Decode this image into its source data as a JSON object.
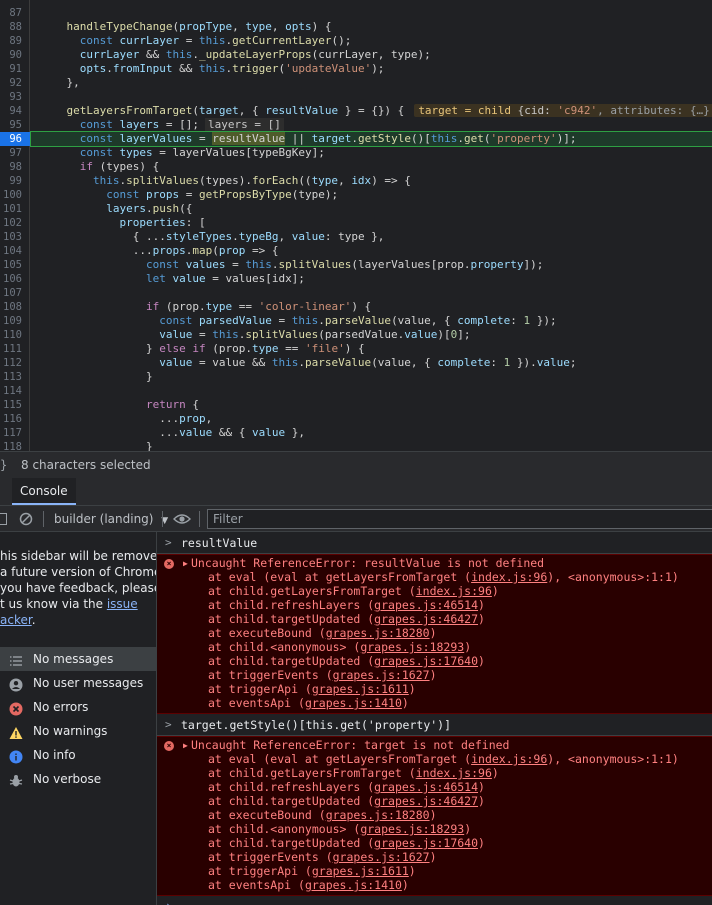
{
  "editor": {
    "active_line": "96",
    "lines": [
      {
        "n": "87",
        "segs": []
      },
      {
        "n": "88",
        "segs": [
          [
            "    ",
            "p"
          ],
          [
            "handleTypeChange",
            "f"
          ],
          [
            "(",
            "p"
          ],
          [
            "propType",
            "v"
          ],
          [
            ", ",
            "p"
          ],
          [
            "type",
            "v"
          ],
          [
            ", ",
            "p"
          ],
          [
            "opts",
            "v"
          ],
          [
            ") {",
            "p"
          ]
        ]
      },
      {
        "n": "89",
        "segs": [
          [
            "      ",
            "p"
          ],
          [
            "const ",
            "k2"
          ],
          [
            "currLayer",
            "v"
          ],
          [
            " = ",
            "p"
          ],
          [
            "this",
            "k2"
          ],
          [
            ".",
            "p"
          ],
          [
            "getCurrentLayer",
            "f"
          ],
          [
            "();",
            "p"
          ]
        ]
      },
      {
        "n": "90",
        "segs": [
          [
            "      ",
            "p"
          ],
          [
            "currLayer",
            "v"
          ],
          [
            " && ",
            "p"
          ],
          [
            "this",
            "k2"
          ],
          [
            ".",
            "p"
          ],
          [
            "_updateLayerProps",
            "f"
          ],
          [
            "(currLayer, type);",
            "p"
          ]
        ]
      },
      {
        "n": "91",
        "segs": [
          [
            "      ",
            "p"
          ],
          [
            "opts",
            "v"
          ],
          [
            ".",
            "p"
          ],
          [
            "fromInput",
            "v"
          ],
          [
            " && ",
            "p"
          ],
          [
            "this",
            "k2"
          ],
          [
            ".",
            "p"
          ],
          [
            "trigger",
            "f"
          ],
          [
            "(",
            "p"
          ],
          [
            "'updateValue'",
            "s"
          ],
          [
            ");",
            "p"
          ]
        ]
      },
      {
        "n": "92",
        "segs": [
          [
            "    },",
            "p"
          ]
        ]
      },
      {
        "n": "93",
        "segs": []
      },
      {
        "n": "94",
        "segs": [
          [
            "    ",
            "p"
          ],
          [
            "getLayersFromTarget",
            "f"
          ],
          [
            "(",
            "p"
          ],
          [
            "target",
            "v"
          ],
          [
            ", { ",
            "p"
          ],
          [
            "resultValue",
            "v"
          ],
          [
            " } = {}) {",
            "p"
          ]
        ],
        "inline": "94"
      },
      {
        "n": "95",
        "segs": [
          [
            "      ",
            "p"
          ],
          [
            "const ",
            "k2"
          ],
          [
            "layers",
            "v"
          ],
          [
            " = [];",
            "p"
          ]
        ],
        "inline": "95"
      },
      {
        "n": "96",
        "segs": [
          [
            "      ",
            "p"
          ],
          [
            "const ",
            "k2"
          ],
          [
            "layerValues",
            "v"
          ],
          [
            " = ",
            "p"
          ],
          [
            "resultValue",
            "sel"
          ],
          [
            " || ",
            "p"
          ],
          [
            "target",
            "v"
          ],
          [
            ".",
            "p"
          ],
          [
            "getStyle",
            "f"
          ],
          [
            "()[",
            "p"
          ],
          [
            "this",
            "k2"
          ],
          [
            ".",
            "p"
          ],
          [
            "get",
            "f"
          ],
          [
            "(",
            "p"
          ],
          [
            "'property'",
            "s"
          ],
          [
            ")];",
            "p"
          ]
        ]
      },
      {
        "n": "97",
        "segs": [
          [
            "      ",
            "p"
          ],
          [
            "const ",
            "k2"
          ],
          [
            "types",
            "v"
          ],
          [
            " = layerValues[typeBgKey];",
            "p"
          ]
        ]
      },
      {
        "n": "98",
        "segs": [
          [
            "      ",
            "p"
          ],
          [
            "if ",
            "k"
          ],
          [
            "(types) {",
            "p"
          ]
        ]
      },
      {
        "n": "99",
        "segs": [
          [
            "        ",
            "p"
          ],
          [
            "this",
            "k2"
          ],
          [
            ".",
            "p"
          ],
          [
            "splitValues",
            "f"
          ],
          [
            "(types).",
            "p"
          ],
          [
            "forEach",
            "f"
          ],
          [
            "((",
            "p"
          ],
          [
            "type",
            "v"
          ],
          [
            ", ",
            "p"
          ],
          [
            "idx",
            "v"
          ],
          [
            ") => {",
            "p"
          ]
        ]
      },
      {
        "n": "100",
        "segs": [
          [
            "          ",
            "p"
          ],
          [
            "const ",
            "k2"
          ],
          [
            "props",
            "v"
          ],
          [
            " = ",
            "p"
          ],
          [
            "getPropsByType",
            "f"
          ],
          [
            "(type);",
            "p"
          ]
        ]
      },
      {
        "n": "101",
        "segs": [
          [
            "          ",
            "p"
          ],
          [
            "layers",
            "v"
          ],
          [
            ".",
            "p"
          ],
          [
            "push",
            "f"
          ],
          [
            "({",
            "p"
          ]
        ]
      },
      {
        "n": "102",
        "segs": [
          [
            "            ",
            "p"
          ],
          [
            "properties",
            "v"
          ],
          [
            ": [",
            "p"
          ]
        ]
      },
      {
        "n": "103",
        "segs": [
          [
            "              { ...",
            "p"
          ],
          [
            "styleTypes",
            "v"
          ],
          [
            ".",
            "p"
          ],
          [
            "typeBg",
            "v"
          ],
          [
            ", ",
            "p"
          ],
          [
            "value",
            "v"
          ],
          [
            ": type },",
            "p"
          ]
        ]
      },
      {
        "n": "104",
        "segs": [
          [
            "              ...",
            "p"
          ],
          [
            "props",
            "v"
          ],
          [
            ".",
            "p"
          ],
          [
            "map",
            "f"
          ],
          [
            "(",
            "p"
          ],
          [
            "prop",
            "v"
          ],
          [
            " => {",
            "p"
          ]
        ]
      },
      {
        "n": "105",
        "segs": [
          [
            "                ",
            "p"
          ],
          [
            "const ",
            "k2"
          ],
          [
            "values",
            "v"
          ],
          [
            " = ",
            "p"
          ],
          [
            "this",
            "k2"
          ],
          [
            ".",
            "p"
          ],
          [
            "splitValues",
            "f"
          ],
          [
            "(layerValues[prop.",
            "p"
          ],
          [
            "property",
            "v"
          ],
          [
            "]);",
            "p"
          ]
        ]
      },
      {
        "n": "106",
        "segs": [
          [
            "                ",
            "p"
          ],
          [
            "let ",
            "k2"
          ],
          [
            "value",
            "v"
          ],
          [
            " = values[idx];",
            "p"
          ]
        ]
      },
      {
        "n": "107",
        "segs": []
      },
      {
        "n": "108",
        "segs": [
          [
            "                ",
            "p"
          ],
          [
            "if ",
            "k"
          ],
          [
            "(prop.",
            "p"
          ],
          [
            "type",
            "v"
          ],
          [
            " == ",
            "p"
          ],
          [
            "'color-linear'",
            "s"
          ],
          [
            ") {",
            "p"
          ]
        ]
      },
      {
        "n": "109",
        "segs": [
          [
            "                  ",
            "p"
          ],
          [
            "const ",
            "k2"
          ],
          [
            "parsedValue",
            "v"
          ],
          [
            " = ",
            "p"
          ],
          [
            "this",
            "k2"
          ],
          [
            ".",
            "p"
          ],
          [
            "parseValue",
            "f"
          ],
          [
            "(value, { ",
            "p"
          ],
          [
            "complete",
            "v"
          ],
          [
            ": ",
            "p"
          ],
          [
            "1",
            "n"
          ],
          [
            " });",
            "p"
          ]
        ]
      },
      {
        "n": "110",
        "segs": [
          [
            "                  ",
            "p"
          ],
          [
            "value",
            "v"
          ],
          [
            " = ",
            "p"
          ],
          [
            "this",
            "k2"
          ],
          [
            ".",
            "p"
          ],
          [
            "splitValues",
            "f"
          ],
          [
            "(parsedValue.",
            "p"
          ],
          [
            "value",
            "v"
          ],
          [
            ")[",
            "p"
          ],
          [
            "0",
            "n"
          ],
          [
            "];",
            "p"
          ]
        ]
      },
      {
        "n": "111",
        "segs": [
          [
            "                } ",
            "p"
          ],
          [
            "else if ",
            "k"
          ],
          [
            "(prop.",
            "p"
          ],
          [
            "type",
            "v"
          ],
          [
            " == ",
            "p"
          ],
          [
            "'file'",
            "s"
          ],
          [
            ") {",
            "p"
          ]
        ]
      },
      {
        "n": "112",
        "segs": [
          [
            "                  ",
            "p"
          ],
          [
            "value",
            "v"
          ],
          [
            " = value && ",
            "p"
          ],
          [
            "this",
            "k2"
          ],
          [
            ".",
            "p"
          ],
          [
            "parseValue",
            "f"
          ],
          [
            "(value, { ",
            "p"
          ],
          [
            "complete",
            "v"
          ],
          [
            ": ",
            "p"
          ],
          [
            "1",
            "n"
          ],
          [
            " }).",
            "p"
          ],
          [
            "value",
            "v"
          ],
          [
            ";",
            "p"
          ]
        ]
      },
      {
        "n": "113",
        "segs": [
          [
            "                }",
            "p"
          ]
        ]
      },
      {
        "n": "114",
        "segs": []
      },
      {
        "n": "115",
        "segs": [
          [
            "                ",
            "p"
          ],
          [
            "return ",
            "k"
          ],
          [
            "{",
            "p"
          ]
        ]
      },
      {
        "n": "116",
        "segs": [
          [
            "                  ...",
            "p"
          ],
          [
            "prop",
            "v"
          ],
          [
            ",",
            "p"
          ]
        ]
      },
      {
        "n": "117",
        "segs": [
          [
            "                  ...",
            "p"
          ],
          [
            "value",
            "v"
          ],
          [
            " && { ",
            "p"
          ],
          [
            "value",
            "v"
          ],
          [
            " },",
            "p"
          ]
        ]
      },
      {
        "n": "118",
        "segs": [
          [
            "                }",
            "p"
          ]
        ]
      }
    ],
    "inline_94": {
      "key": "target = child ",
      "rest1": "{cid: ",
      "cid": "'c942'",
      "rest2": ", attributes: {…}"
    },
    "inline_95": "layers = []"
  },
  "status": {
    "brace": "}",
    "selection": "8 characters selected"
  },
  "drawer": {
    "console_tab": "Console"
  },
  "toolbar": {
    "context": "builder (landing)",
    "context_arrow": "▼",
    "filter_placeholder": "Filter"
  },
  "sidebar": {
    "deprecation": [
      "his sidebar will be removed",
      " a future version of Chrome.",
      " you have feedback, please",
      "t us know via the "
    ],
    "link1": "issue",
    "link2": "acker",
    "link2_tail": ".",
    "items": [
      {
        "label": "No messages",
        "icon": "list-icon",
        "active": true
      },
      {
        "label": "No user messages",
        "icon": "user-icon"
      },
      {
        "label": "No errors",
        "icon": "error-icon",
        "color": "#e46962"
      },
      {
        "label": "No warnings",
        "icon": "warning-icon",
        "color": "#fdd663"
      },
      {
        "label": "No info",
        "icon": "info-icon",
        "color": "#4285f4"
      },
      {
        "label": "No verbose",
        "icon": "bug-icon"
      }
    ]
  },
  "console": {
    "cmd1": "resultValue",
    "err1": "Uncaught ReferenceError: resultValue is not defined",
    "cmd2": "target.getStyle()[this.get('property')]",
    "err2": "Uncaught ReferenceError: target is not defined",
    "stack": [
      {
        "pre": "at eval (eval at getLayersFromTarget (",
        "link": "index.js:96",
        "post": "), <anonymous>:1:1)"
      },
      {
        "pre": "at child.getLayersFromTarget (",
        "link": "index.js:96",
        "post": ")"
      },
      {
        "pre": "at child.refreshLayers (",
        "link": "grapes.js:46514",
        "post": ")"
      },
      {
        "pre": "at child.targetUpdated (",
        "link": "grapes.js:46427",
        "post": ")"
      },
      {
        "pre": "at executeBound (",
        "link": "grapes.js:18280",
        "post": ")"
      },
      {
        "pre": "at child.<anonymous> (",
        "link": "grapes.js:18293",
        "post": ")"
      },
      {
        "pre": "at child.targetUpdated (",
        "link": "grapes.js:17640",
        "post": ")"
      },
      {
        "pre": "at triggerEvents (",
        "link": "grapes.js:1627",
        "post": ")"
      },
      {
        "pre": "at triggerApi (",
        "link": "grapes.js:1611",
        "post": ")"
      },
      {
        "pre": "at eventsApi (",
        "link": "grapes.js:1410",
        "post": ")"
      }
    ],
    "prompt": "›"
  }
}
